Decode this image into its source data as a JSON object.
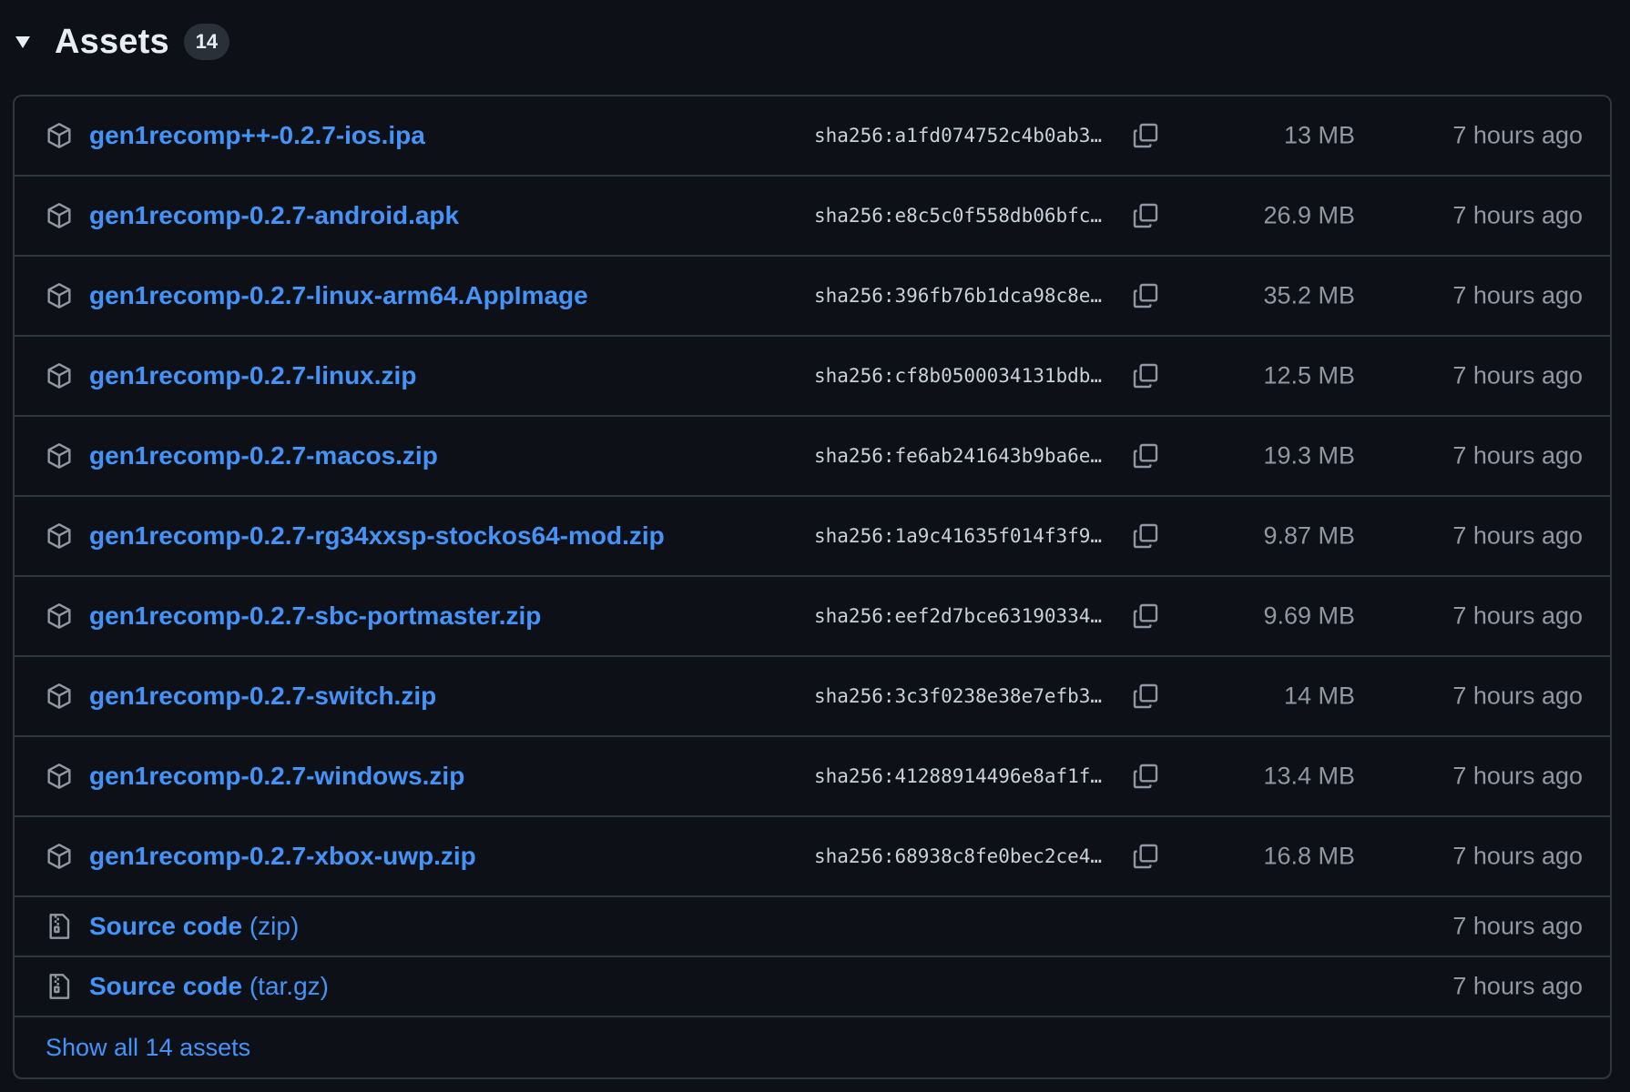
{
  "header": {
    "title": "Assets",
    "count": "14"
  },
  "assets": [
    {
      "name": "gen1recomp++-0.2.7-ios.ipa",
      "sha": "sha256:a1fd074752c4b0ab3…",
      "size": "13 MB",
      "time": "7 hours ago"
    },
    {
      "name": "gen1recomp-0.2.7-android.apk",
      "sha": "sha256:e8c5c0f558db06bfc…",
      "size": "26.9 MB",
      "time": "7 hours ago"
    },
    {
      "name": "gen1recomp-0.2.7-linux-arm64.AppImage",
      "sha": "sha256:396fb76b1dca98c8e…",
      "size": "35.2 MB",
      "time": "7 hours ago"
    },
    {
      "name": "gen1recomp-0.2.7-linux.zip",
      "sha": "sha256:cf8b0500034131bdb…",
      "size": "12.5 MB",
      "time": "7 hours ago"
    },
    {
      "name": "gen1recomp-0.2.7-macos.zip",
      "sha": "sha256:fe6ab241643b9ba6e…",
      "size": "19.3 MB",
      "time": "7 hours ago"
    },
    {
      "name": "gen1recomp-0.2.7-rg34xxsp-stockos64-mod.zip",
      "sha": "sha256:1a9c41635f014f3f9…",
      "size": "9.87 MB",
      "time": "7 hours ago"
    },
    {
      "name": "gen1recomp-0.2.7-sbc-portmaster.zip",
      "sha": "sha256:eef2d7bce63190334…",
      "size": "9.69 MB",
      "time": "7 hours ago"
    },
    {
      "name": "gen1recomp-0.2.7-switch.zip",
      "sha": "sha256:3c3f0238e38e7efb3…",
      "size": "14 MB",
      "time": "7 hours ago"
    },
    {
      "name": "gen1recomp-0.2.7-windows.zip",
      "sha": "sha256:41288914496e8af1f…",
      "size": "13.4 MB",
      "time": "7 hours ago"
    },
    {
      "name": "gen1recomp-0.2.7-xbox-uwp.zip",
      "sha": "sha256:68938c8fe0bec2ce4…",
      "size": "16.8 MB",
      "time": "7 hours ago"
    }
  ],
  "source_code": [
    {
      "label": "Source code",
      "ext": "(zip)",
      "time": "7 hours ago"
    },
    {
      "label": "Source code",
      "ext": "(tar.gz)",
      "time": "7 hours ago"
    }
  ],
  "show_all_label": "Show all 14 assets",
  "icons": {
    "caret": "triangle-down-icon",
    "package": "package-icon",
    "zip": "file-zip-icon",
    "copy": "copy-icon"
  },
  "colors": {
    "background": "#0d1117",
    "border": "#30363d",
    "link": "#4493f8",
    "muted": "#9198a1",
    "badge": "#2a3038"
  }
}
